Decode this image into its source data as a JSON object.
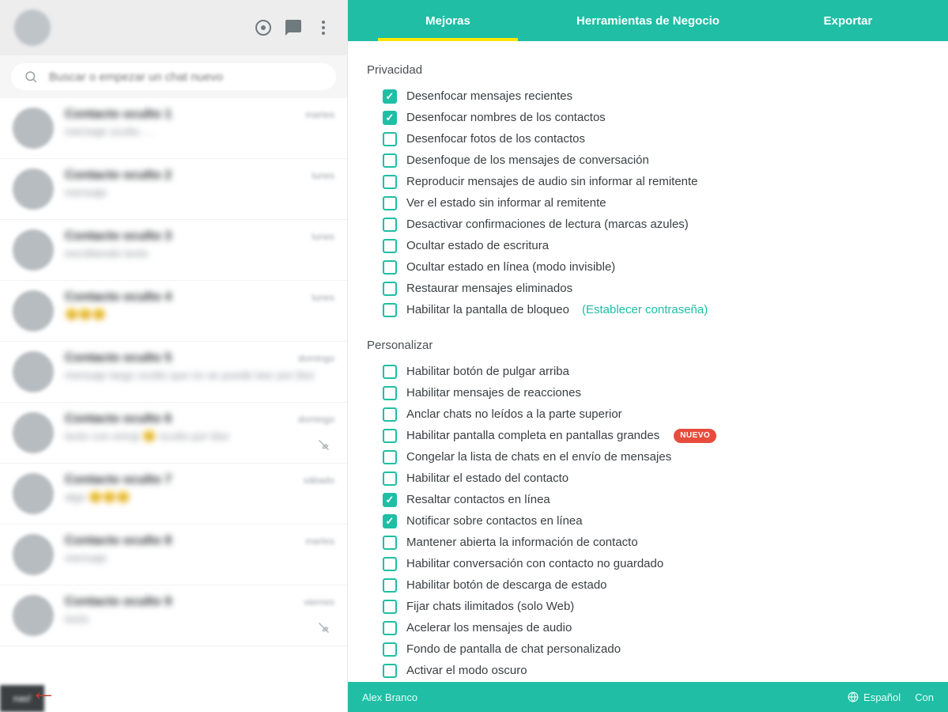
{
  "sidebar": {
    "search_placeholder": "Buscar o empezar un chat nuevo",
    "chats": [
      {
        "name": "Contacto oculto 1",
        "msg": "mensaje oculto …",
        "time": "martes",
        "muted": false
      },
      {
        "name": "Contacto oculto 2",
        "msg": "mensaje",
        "time": "lunes",
        "muted": false
      },
      {
        "name": "Contacto oculto 3",
        "msg": "escribiendo texto",
        "time": "lunes",
        "muted": false
      },
      {
        "name": "Contacto oculto 4",
        "msg": "😊😊😊",
        "time": "lunes",
        "muted": false
      },
      {
        "name": "Contacto oculto 5",
        "msg": "mensaje largo oculto que no se puede leer por blur",
        "time": "domingo",
        "muted": false
      },
      {
        "name": "Contacto oculto 6",
        "msg": "texto con emoji 😊 oculto por blur",
        "time": "domingo",
        "muted": true
      },
      {
        "name": "Contacto oculto 7",
        "msg": "algo 😊😊😊",
        "time": "sábado",
        "muted": false
      },
      {
        "name": "Contacto oculto 8",
        "msg": "mensaje",
        "time": "martes",
        "muted": false
      },
      {
        "name": "Contacto oculto 9",
        "msg": "texto",
        "time": "viernes",
        "muted": true
      }
    ],
    "tooltip": "nas!"
  },
  "tabs": {
    "improvements": "Mejoras",
    "business": "Herramientas de Negocio",
    "export": "Exportar"
  },
  "sections": {
    "privacy": {
      "title": "Privacidad",
      "items": [
        {
          "checked": true,
          "label": "Desenfocar mensajes recientes"
        },
        {
          "checked": true,
          "label": "Desenfocar nombres de los contactos"
        },
        {
          "checked": false,
          "label": "Desenfocar fotos de los contactos"
        },
        {
          "checked": false,
          "label": "Desenfoque de los mensajes de conversación"
        },
        {
          "checked": false,
          "label": "Reproducir mensajes de audio sin informar al remitente"
        },
        {
          "checked": false,
          "label": "Ver el estado sin informar al remitente"
        },
        {
          "checked": false,
          "label": "Desactivar confirmaciones de lectura (marcas azules)"
        },
        {
          "checked": false,
          "label": "Ocultar estado de escritura"
        },
        {
          "checked": false,
          "label": "Ocultar estado en línea (modo invisible)"
        },
        {
          "checked": false,
          "label": "Restaurar mensajes eliminados"
        },
        {
          "checked": false,
          "label": "Habilitar la pantalla de bloqueo",
          "link": "(Establecer contraseña)"
        }
      ]
    },
    "customize": {
      "title": "Personalizar",
      "items": [
        {
          "checked": false,
          "label": "Habilitar botón de pulgar arriba"
        },
        {
          "checked": false,
          "label": "Habilitar mensajes de reacciones"
        },
        {
          "checked": false,
          "label": "Anclar chats no leídos a la parte superior"
        },
        {
          "checked": false,
          "label": "Habilitar pantalla completa en pantallas grandes",
          "badge": "NUEVO"
        },
        {
          "checked": false,
          "label": "Congelar la lista de chats en el envío de mensajes"
        },
        {
          "checked": false,
          "label": "Habilitar el estado del contacto"
        },
        {
          "checked": true,
          "label": "Resaltar contactos en línea"
        },
        {
          "checked": true,
          "label": "Notificar sobre contactos en línea"
        },
        {
          "checked": false,
          "label": "Mantener abierta la información de contacto"
        },
        {
          "checked": false,
          "label": "Habilitar conversación con contacto no guardado"
        },
        {
          "checked": false,
          "label": "Habilitar botón de descarga de estado"
        },
        {
          "checked": false,
          "label": "Fijar chats ilimitados (solo Web)"
        },
        {
          "checked": false,
          "label": "Acelerar los mensajes de audio"
        },
        {
          "checked": false,
          "label": "Fondo de pantalla de chat personalizado"
        },
        {
          "checked": false,
          "label": "Activar el modo oscuro"
        }
      ]
    }
  },
  "footer": {
    "author": "Alex Branco",
    "lang": "Español",
    "share": "Con"
  }
}
